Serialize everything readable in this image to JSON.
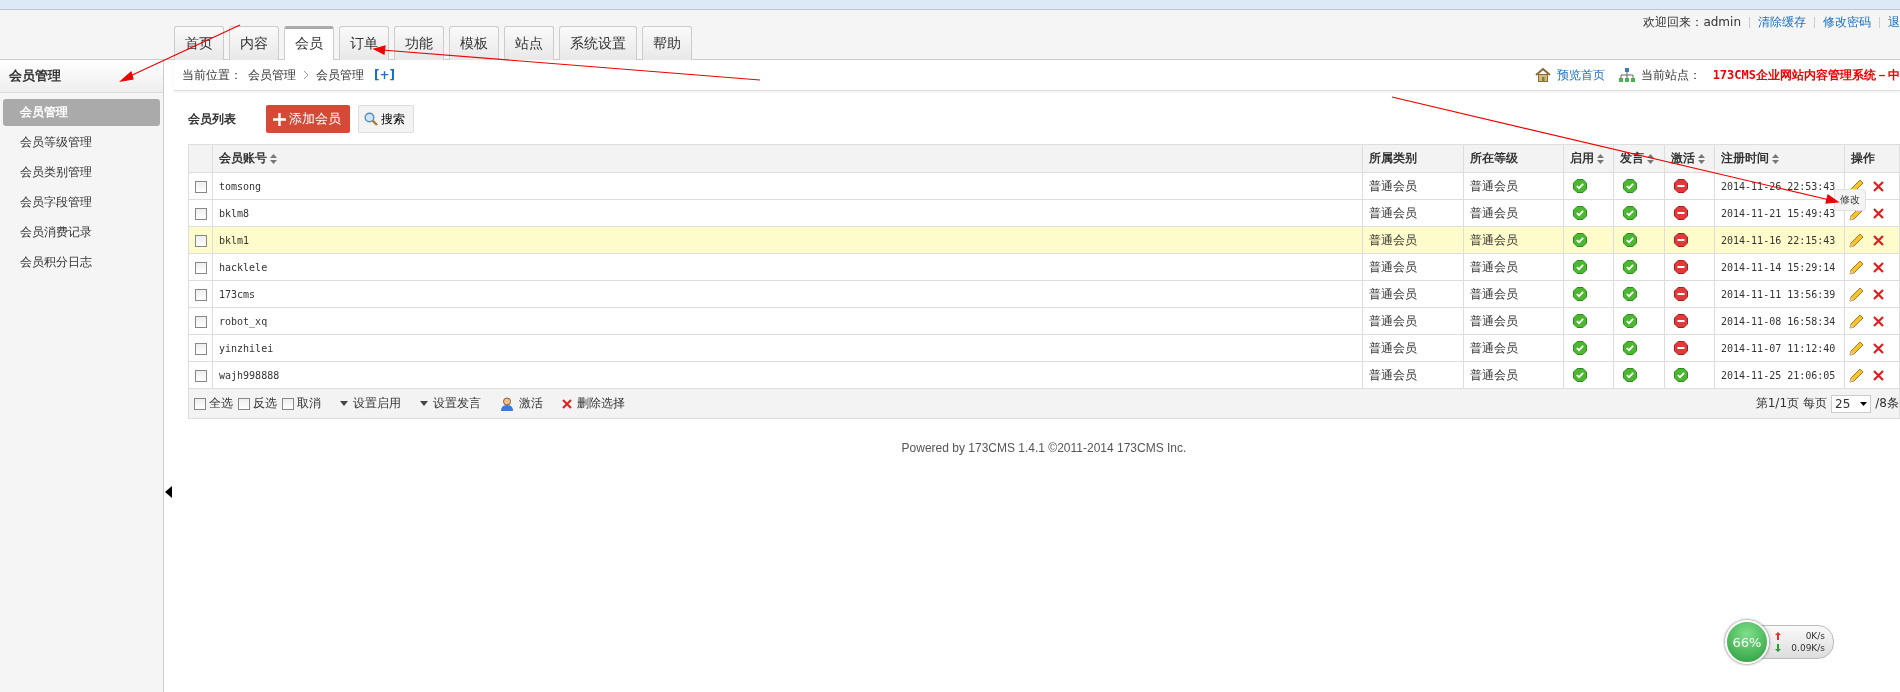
{
  "header": {
    "welcome": "欢迎回来：admin",
    "links": [
      "清除缓存",
      "修改密码",
      "退"
    ]
  },
  "tabs": [
    {
      "label": "首页",
      "selected": false
    },
    {
      "label": "内容",
      "selected": false
    },
    {
      "label": "会员",
      "selected": true
    },
    {
      "label": "订单",
      "selected": false
    },
    {
      "label": "功能",
      "selected": false
    },
    {
      "label": "模板",
      "selected": false
    },
    {
      "label": "站点",
      "selected": false
    },
    {
      "label": "系统设置",
      "selected": false
    },
    {
      "label": "帮助",
      "selected": false
    }
  ],
  "sidebar": {
    "title": "会员管理",
    "items": [
      {
        "label": "会员管理",
        "selected": true
      },
      {
        "label": "会员等级管理",
        "selected": false
      },
      {
        "label": "会员类别管理",
        "selected": false
      },
      {
        "label": "会员字段管理",
        "selected": false
      },
      {
        "label": "会员消费记录",
        "selected": false
      },
      {
        "label": "会员积分日志",
        "selected": false
      }
    ]
  },
  "breadcrumb": {
    "prefix": "当前位置：",
    "items": [
      "会员管理",
      "会员管理"
    ],
    "toggle": "[+]",
    "preview": "预览首页",
    "site_label": "当前站点：",
    "site_name": "173CMS企业网站内容管理系统－中"
  },
  "list": {
    "title": "会员列表",
    "add_button": "添加会员",
    "search_button": "搜索"
  },
  "table": {
    "columns": [
      {
        "label": "会员账号",
        "sortable": true
      },
      {
        "label": "所属类别",
        "sortable": false
      },
      {
        "label": "所在等级",
        "sortable": false
      },
      {
        "label": "启用",
        "sortable": true
      },
      {
        "label": "发言",
        "sortable": true
      },
      {
        "label": "激活",
        "sortable": true
      },
      {
        "label": "注册时间",
        "sortable": true
      },
      {
        "label": "操作",
        "sortable": false
      }
    ],
    "rows": [
      {
        "account": "tomsong",
        "category": "普通会员",
        "level": "普通会员",
        "enabled": true,
        "can_post": true,
        "activated": false,
        "registered": "2014-11-26 22:53:43",
        "checked": false,
        "highlighted": false
      },
      {
        "account": "bklm8",
        "category": "普通会员",
        "level": "普通会员",
        "enabled": true,
        "can_post": true,
        "activated": false,
        "registered": "2014-11-21 15:49:43",
        "checked": false,
        "highlighted": false
      },
      {
        "account": "bklm1",
        "category": "普通会员",
        "level": "普通会员",
        "enabled": true,
        "can_post": true,
        "activated": false,
        "registered": "2014-11-16 22:15:43",
        "checked": false,
        "highlighted": true
      },
      {
        "account": "hacklele",
        "category": "普通会员",
        "level": "普通会员",
        "enabled": true,
        "can_post": true,
        "activated": false,
        "registered": "2014-11-14 15:29:14",
        "checked": false,
        "highlighted": false
      },
      {
        "account": "173cms",
        "category": "普通会员",
        "level": "普通会员",
        "enabled": true,
        "can_post": true,
        "activated": false,
        "registered": "2014-11-11 13:56:39",
        "checked": false,
        "highlighted": false
      },
      {
        "account": "robot_xq",
        "category": "普通会员",
        "level": "普通会员",
        "enabled": true,
        "can_post": true,
        "activated": false,
        "registered": "2014-11-08 16:58:34",
        "checked": false,
        "highlighted": false
      },
      {
        "account": "yinzhilei",
        "category": "普通会员",
        "level": "普通会员",
        "enabled": true,
        "can_post": true,
        "activated": false,
        "registered": "2014-11-07 11:12:40",
        "checked": false,
        "highlighted": false
      },
      {
        "account": "wajh998888",
        "category": "普通会员",
        "level": "普通会员",
        "enabled": true,
        "can_post": true,
        "activated": true,
        "registered": "2014-11-25 21:06:05",
        "checked": false,
        "highlighted": false
      }
    ],
    "tooltip": "修改"
  },
  "footer_bar": {
    "select_options": [
      {
        "label": "全选",
        "checked": false
      },
      {
        "label": "反选",
        "checked": false
      },
      {
        "label": "取消",
        "checked": false
      }
    ],
    "actions": [
      {
        "kind": "dropdown",
        "label": "设置启用"
      },
      {
        "kind": "dropdown",
        "label": "设置发言"
      },
      {
        "kind": "user",
        "label": "激活"
      },
      {
        "kind": "delete",
        "label": "删除选择"
      }
    ],
    "page_info": "第1/1页",
    "per_page_label": "每页",
    "per_page": "25",
    "total": "/8条"
  },
  "powered_by": "Powered by 173CMS 1.4.1 ©2011-2014  173CMS Inc.",
  "net_monitor": {
    "percent": "66%",
    "upload": "0K/s",
    "download": "0.09K/s"
  }
}
